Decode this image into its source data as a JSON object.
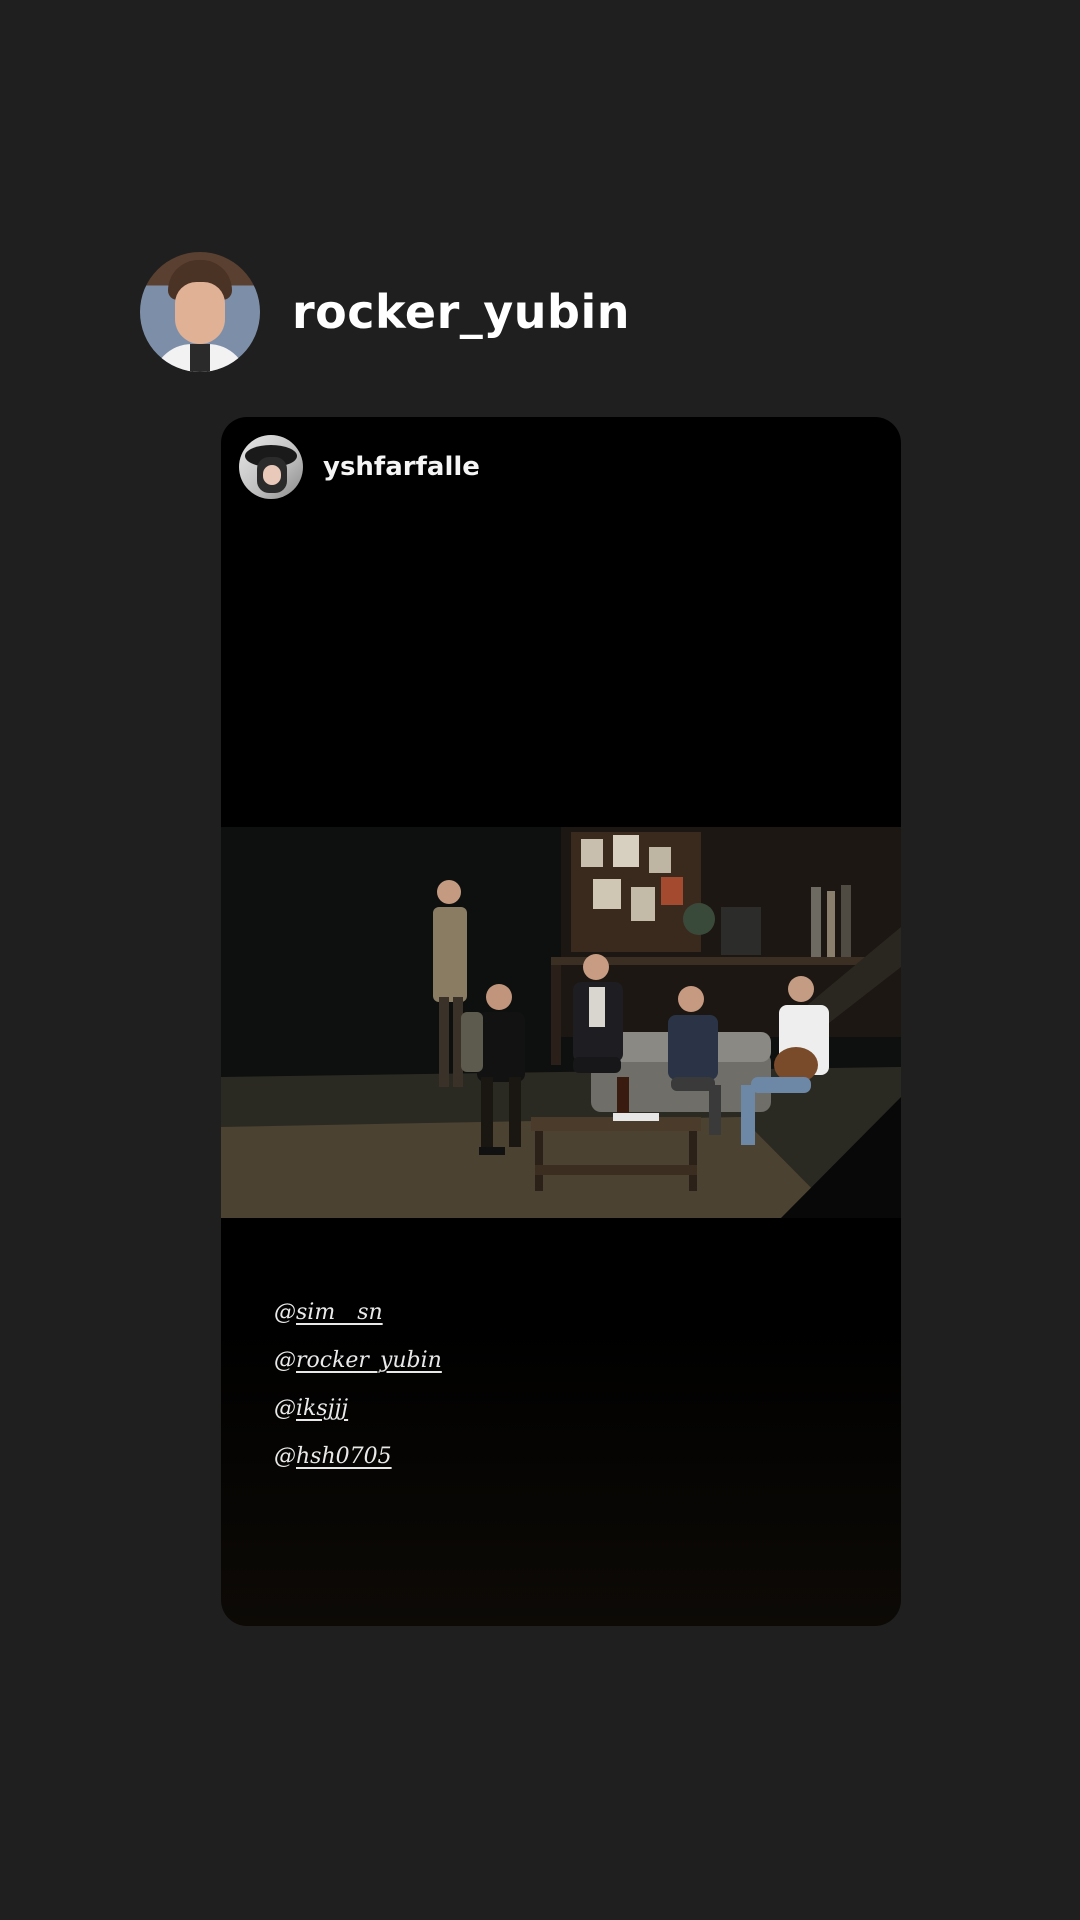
{
  "header": {
    "username": "rocker_yubin"
  },
  "card": {
    "username": "yshfarfalle",
    "mentions": [
      {
        "prefix": "@",
        "handle": "sim__sn"
      },
      {
        "prefix": "@",
        "handle": "rocker_yubin"
      },
      {
        "prefix": "@",
        "handle": "iksjjj"
      },
      {
        "prefix": "@",
        "handle": "hsh0705"
      }
    ]
  },
  "colors": {
    "background": "#1f1f1f",
    "card_background": "#000000",
    "text_primary": "#ffffff"
  }
}
